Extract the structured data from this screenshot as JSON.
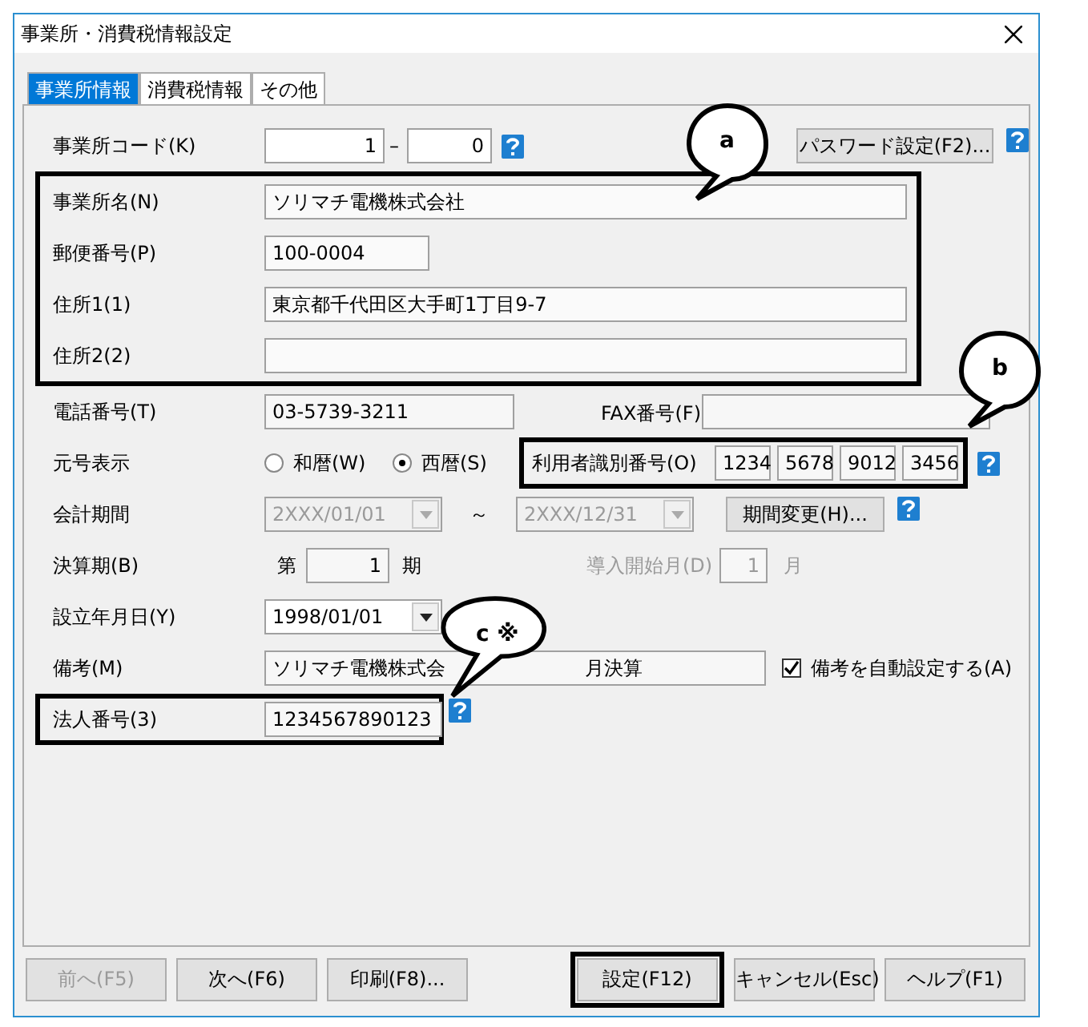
{
  "window": {
    "title": "事業所・消費税情報設定"
  },
  "tabs": [
    {
      "label": "事業所情報",
      "selected": true
    },
    {
      "label": "消費税情報",
      "selected": false
    },
    {
      "label": "その他",
      "selected": false
    }
  ],
  "office_code": {
    "label": "事業所コード(K)",
    "value_1": "1",
    "separator": "–",
    "value_2": "0"
  },
  "password_button": "パスワード設定(F2)...",
  "address_group": [
    {
      "label": "事業所名(N)",
      "value": "ソリマチ電機株式会社",
      "kind": "long"
    },
    {
      "label": "郵便番号(P)",
      "value": "100-0004",
      "kind": "short"
    },
    {
      "label": "住所1(1)",
      "value": "東京都千代田区大手町1丁目9-7",
      "kind": "long"
    },
    {
      "label": "住所2(2)",
      "kind": "long"
    }
  ],
  "phone": {
    "label": "電話番号(T)",
    "value": "03-5739-3211"
  },
  "fax": {
    "label": "FAX番号(F)"
  },
  "era": {
    "label": "元号表示",
    "options": [
      {
        "label": "和暦(W)",
        "selected": false
      },
      {
        "label": "西暦(S)",
        "selected": true
      }
    ]
  },
  "user_id": {
    "label": "利用者識別番号(O)",
    "values": [
      "1234",
      "5678",
      "9012",
      "3456"
    ]
  },
  "period": {
    "label": "会計期間",
    "start": "2XXX/01/01",
    "tilde": "～",
    "end": "2XXX/12/31",
    "disabled": true,
    "button": "期間変更(H)..."
  },
  "closing_term": {
    "label": "決算期(B)",
    "prefix": "第",
    "value": "1",
    "suffix": "期"
  },
  "start_month": {
    "label": "導入開始月(D)",
    "value": "1",
    "suffix": "月",
    "disabled": true
  },
  "founded": {
    "label": "設立年月日(Y)",
    "value": "1998/01/01"
  },
  "note": {
    "label": "備考(M)",
    "value_parts": [
      "ソリマチ電機株式会",
      "月決算"
    ],
    "auto": {
      "label": "備考を自動設定する(A)",
      "checked": true
    }
  },
  "corporate_number": {
    "label": "法人番号(3)",
    "value": "1234567890123"
  },
  "callouts": [
    {
      "label": "a"
    },
    {
      "label": "b"
    },
    {
      "label": "c ※"
    }
  ],
  "buttons": [
    {
      "label": "前へ(F5)",
      "disabled": true,
      "highlighted": false
    },
    {
      "label": "次へ(F6)",
      "disabled": false,
      "highlighted": false
    },
    {
      "label": "印刷(F8)...",
      "disabled": false,
      "highlighted": false
    },
    {
      "label": "設定(F12)",
      "disabled": false,
      "highlighted": true
    },
    {
      "label": "キャンセル(Esc)",
      "disabled": false,
      "highlighted": false
    },
    {
      "label": "ヘルプ(F1)",
      "disabled": false,
      "highlighted": false
    }
  ]
}
